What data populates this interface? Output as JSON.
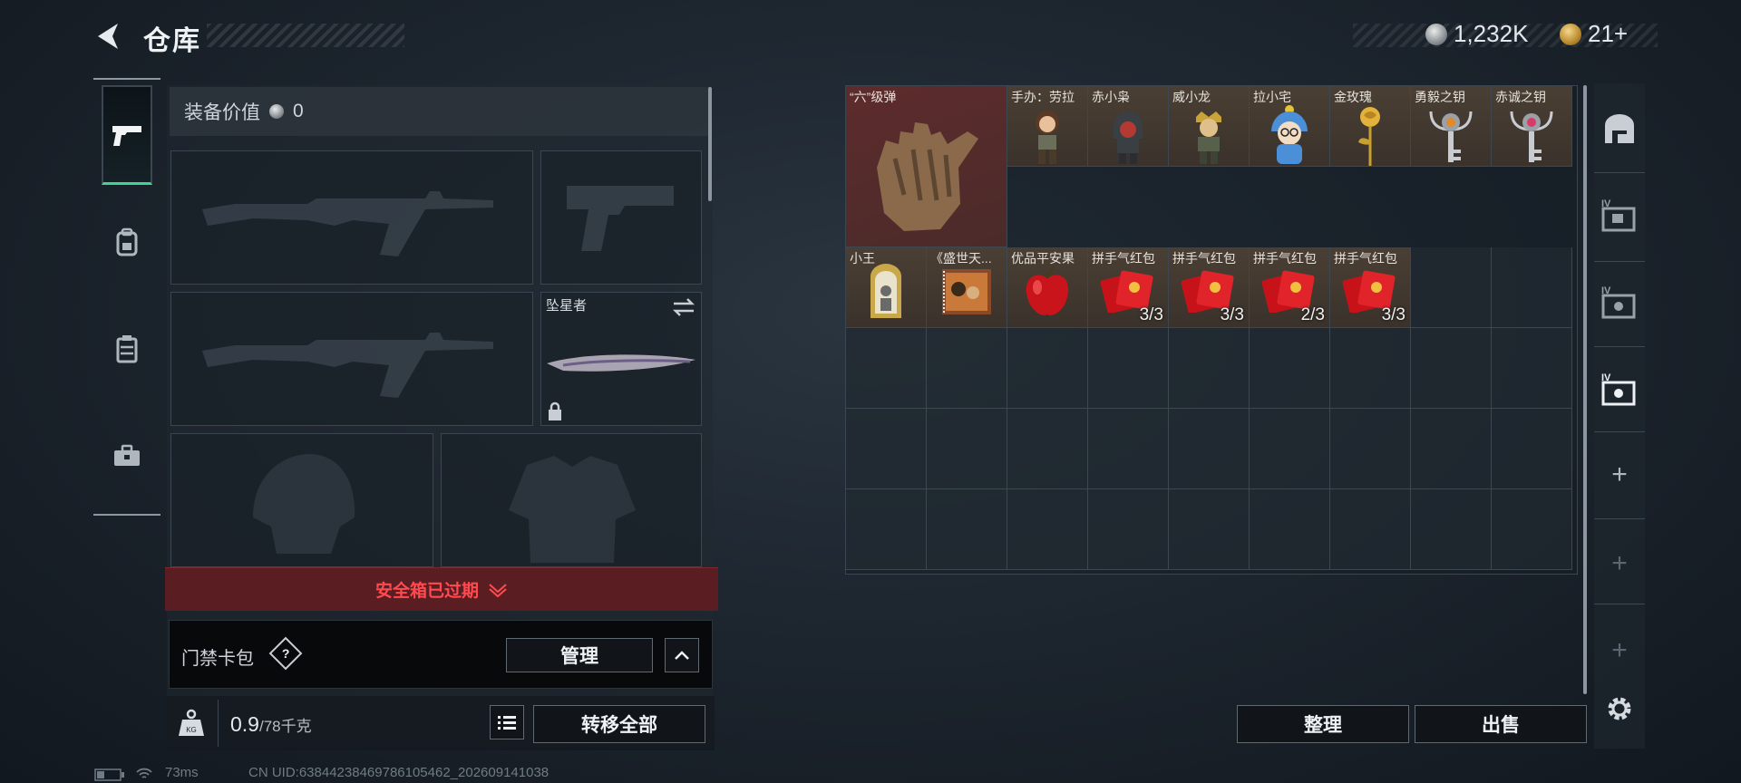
{
  "header": {
    "title": "仓库",
    "currency_silver": "1,232K",
    "currency_gold": "21+"
  },
  "left": {
    "equip_value_label": "装备价值",
    "equip_value": "0",
    "melee_slot_name": "坠星者",
    "safebox_notice": "安全箱已过期",
    "keybag_label": "门禁卡包",
    "help_mark": "?",
    "manage_label": "管理",
    "weight_value": "0.9",
    "weight_capacity": "/78千克",
    "transfer_all_label": "转移全部"
  },
  "status": {
    "ping": "73ms",
    "uid": "CN UID:6384423846978610546​2_202609141038"
  },
  "stash": {
    "items": [
      {
        "name": "“六”级弹",
        "count": ""
      },
      {
        "name": "手办：劳拉",
        "count": ""
      },
      {
        "name": "赤小枭",
        "count": ""
      },
      {
        "name": "威小龙",
        "count": ""
      },
      {
        "name": "拉小宅",
        "count": ""
      },
      {
        "name": "金玫瑰",
        "count": ""
      },
      {
        "name": "勇毅之钥",
        "count": ""
      },
      {
        "name": "赤诚之钥",
        "count": ""
      },
      {
        "name": "小王",
        "count": ""
      },
      {
        "name": "《盛世天...",
        "count": ""
      },
      {
        "name": "优品平安果",
        "count": ""
      },
      {
        "name": "拼手气红包",
        "count": "3/3"
      },
      {
        "name": "拼手气红包",
        "count": "3/3"
      },
      {
        "name": "拼手气红包",
        "count": "2/3"
      },
      {
        "name": "拼手气红包",
        "count": "3/3"
      }
    ],
    "sort_label": "整理",
    "sell_label": "出售"
  },
  "colors": {
    "accent_green": "#3dd58f",
    "expired_red": "#ff4b50",
    "item_bg": "#4a3f34"
  }
}
